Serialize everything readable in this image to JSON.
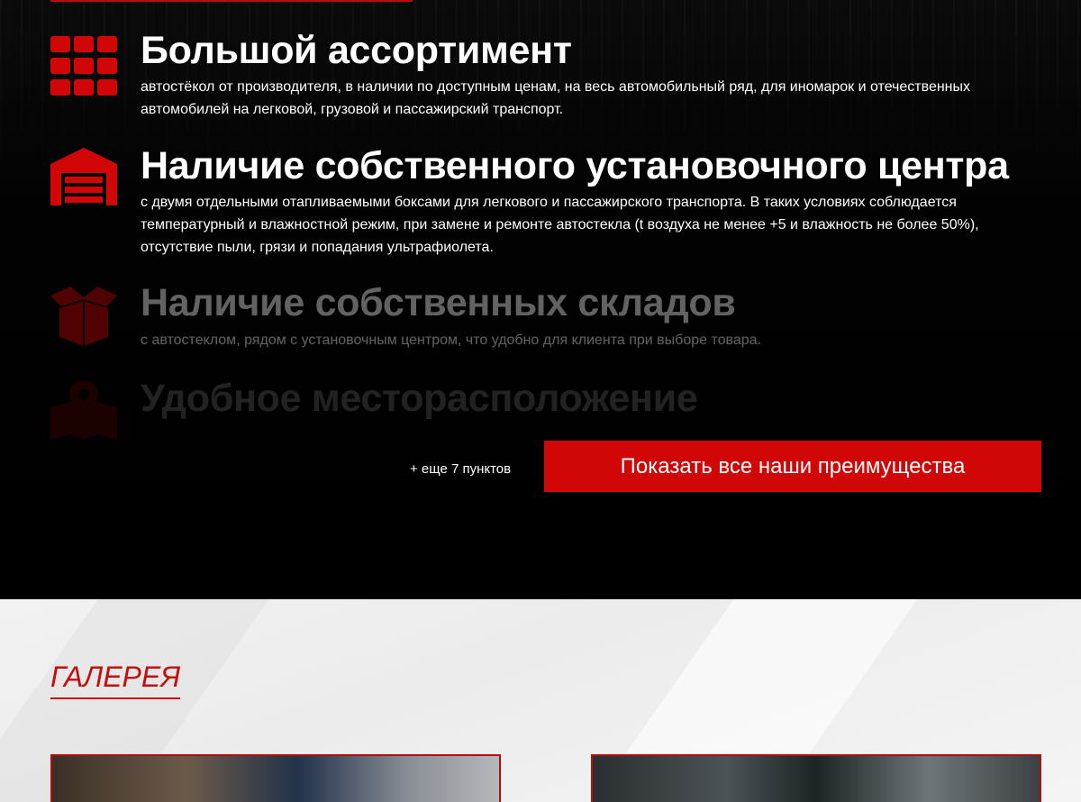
{
  "features": [
    {
      "icon": "grid-icon",
      "title": "Большой ассортимент",
      "description": "автостёкол от производителя, в наличии по доступным ценам, на весь автомобильный ряд, для иномарок и отечественных автомобилей на легковой, грузовой и пассажирский транспорт."
    },
    {
      "icon": "garage-icon",
      "title": "Наличие собственного установочного центра",
      "description": "с двумя отдельными отапливаемыми боксами для легкового и пассажирского транспорта. В таких условиях соблюдается температурный и влажностной режим, при замене и ремонте автостекла (t воздуха не менее +5 и влажность не более 50%), отсутствие пыли, грязи и попадания ультрафиолета."
    },
    {
      "icon": "box-icon",
      "title": "Наличие собственных складов",
      "description": "с автостеклом, рядом с установочным центром, что удобно для клиента при выборе товара."
    },
    {
      "icon": "map-pin-icon",
      "title": "Удобное месторасположение"
    }
  ],
  "more": {
    "label": "+ еще 7 пунктов",
    "button_label": "Показать все наши преимущества"
  },
  "gallery": {
    "title": "ГАЛЕРЕЯ"
  },
  "colors": {
    "accent": "#d10606",
    "background_dark": "#000000",
    "background_light": "#f0f0f0"
  }
}
